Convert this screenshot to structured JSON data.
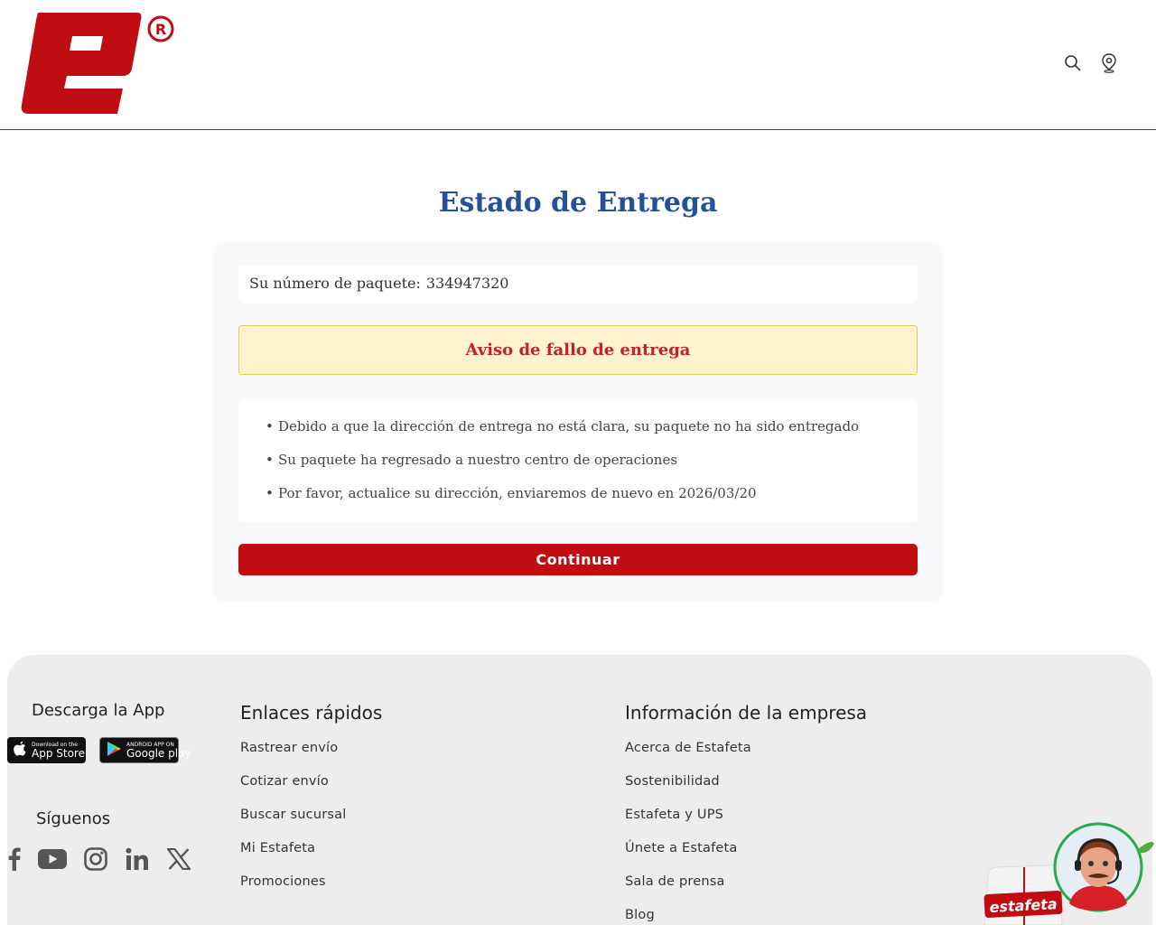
{
  "header": {
    "logo_alt": "Estafeta",
    "search_icon": "search-icon",
    "location_icon": "location-pin-icon"
  },
  "main": {
    "title": "Estado de Entrega",
    "package_label": "Su número de paquete:",
    "package_number": "334947320",
    "alert_text": "Aviso de fallo de entrega",
    "messages": [
      "Debido a que la dirección de entrega no está clara, su paquete no ha sido entregado",
      "Su paquete ha regresado a nuestro centro de operaciones",
      "Por favor, actualice su dirección, enviaremos de nuevo en 2026/03/20"
    ],
    "continue_label": "Continuar"
  },
  "footer": {
    "app_title": "Descarga la App",
    "app_store": {
      "small": "Download on the",
      "big": "App Store"
    },
    "google_play": {
      "small": "ANDROID APP ON",
      "big": "Google play"
    },
    "follow_title": "Síguenos",
    "socials": [
      "facebook-icon",
      "youtube-icon",
      "instagram-icon",
      "linkedin-icon",
      "x-icon"
    ],
    "quick_links_title": "Enlaces rápidos",
    "quick_links": [
      "Rastrear envío",
      "Cotizar envío",
      "Buscar sucursal",
      "Mi Estafeta",
      "Promociones"
    ],
    "company_title": "Información de la empresa",
    "company_links": [
      "Acerca de Estafeta",
      "Sostenibilidad",
      "Estafeta y UPS",
      "Únete a Estafeta",
      "Sala de prensa",
      "Blog"
    ],
    "mascot_brand": "estafeta"
  },
  "colors": {
    "brand_red": "#c00d12",
    "title_blue": "#24529a",
    "alert_bg": "#fff3cd",
    "alert_text": "#c0242a"
  }
}
